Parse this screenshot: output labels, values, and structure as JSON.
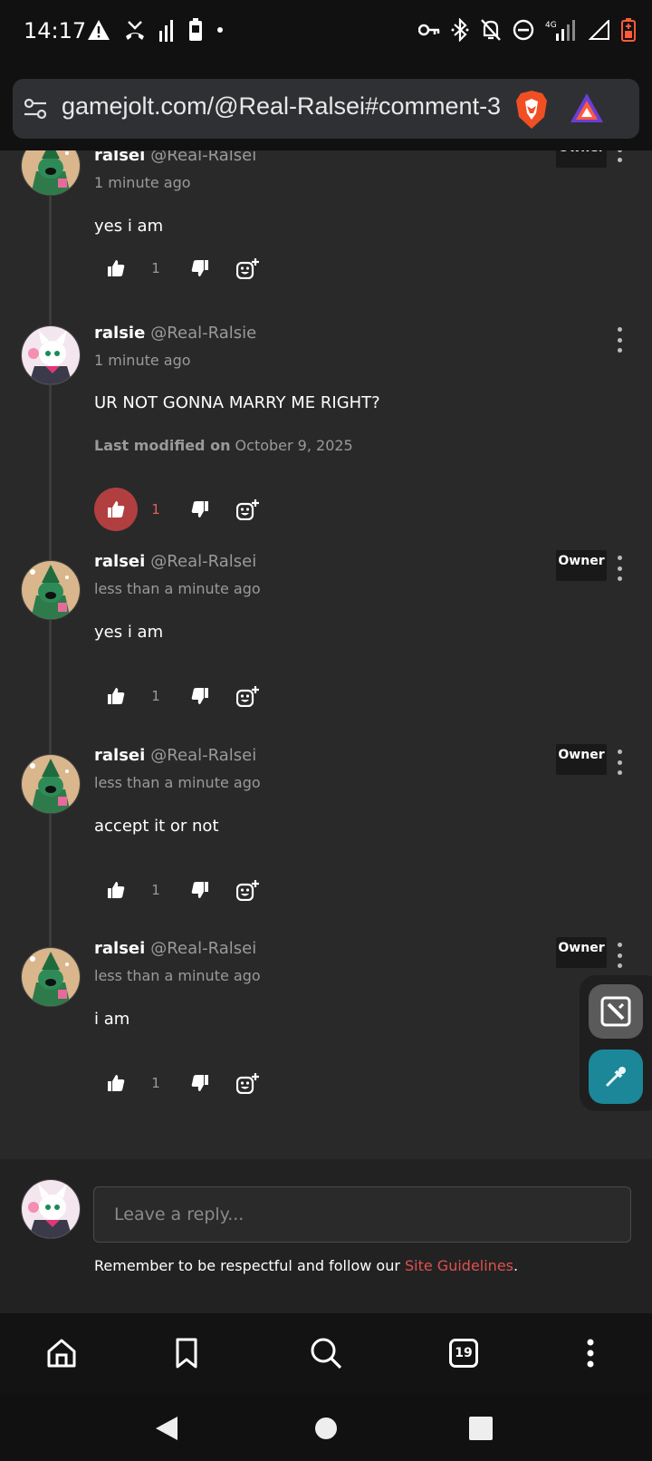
{
  "status_bar": {
    "time": "14:17",
    "network_label": "4G"
  },
  "browser": {
    "url": "gamejolt.com/@Real-Ralsei#comment-3",
    "tab_count": "19"
  },
  "comments": [
    {
      "name": "ralsei",
      "handle": "@Real-Ralsei",
      "time": "1 minute ago",
      "body": "yes i am",
      "likes": "1",
      "owner": "Owner"
    },
    {
      "name": "ralsie",
      "handle": "@Real-Ralsie",
      "time": "1 minute ago",
      "body": "UR NOT GONNA MARRY ME RIGHT?",
      "modified_label": "Last modified on",
      "modified_date": "October 9, 2025",
      "likes": "1"
    },
    {
      "name": "ralsei",
      "handle": "@Real-Ralsei",
      "time": "less than a minute ago",
      "body": "yes i am",
      "likes": "1",
      "owner": "Owner"
    },
    {
      "name": "ralsei",
      "handle": "@Real-Ralsei",
      "time": "less than a minute ago",
      "body": "accept it or not",
      "likes": "1",
      "owner": "Owner"
    },
    {
      "name": "ralsei",
      "handle": "@Real-Ralsei",
      "time": "less than a minute ago",
      "body": "i am",
      "likes": "1",
      "owner": "Owner"
    }
  ],
  "reply": {
    "placeholder": "Leave a reply...",
    "note_prefix": "Remember to be respectful and follow our ",
    "note_link": "Site Guidelines",
    "note_suffix": "."
  },
  "colors": {
    "like_active": "#b13f3f",
    "link": "#e05050",
    "fab_pen": "#1b8799"
  },
  "icons": {
    "nav": [
      "home-icon",
      "bookmark-icon",
      "search-icon",
      "tabs-icon",
      "more-icon"
    ],
    "system": [
      "back-icon",
      "home-circle-icon",
      "recents-icon"
    ]
  }
}
